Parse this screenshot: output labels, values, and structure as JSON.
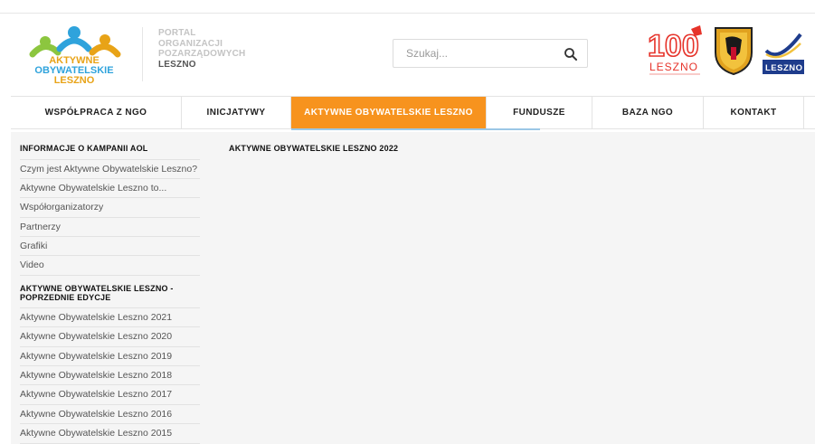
{
  "header": {
    "logo": {
      "line1": "AKTYWNE",
      "line2": "OBYWATELSKIE",
      "line3": "LESZNO"
    },
    "portal": {
      "line1": "PORTAL",
      "line2": "ORGANIZACJI",
      "line3": "POZARZĄDOWYCH",
      "line4": "LESZNO"
    },
    "search": {
      "placeholder": "Szukaj..."
    },
    "partner_logos": {
      "logo100_text": "LESZNO",
      "leszno3_text": "LESZNO"
    }
  },
  "nav": {
    "items": [
      {
        "label": "WSPÓŁPRACA Z NGO"
      },
      {
        "label": "INICJATYWY"
      },
      {
        "label": "AKTYWNE OBYWATELSKIE LESZNO"
      },
      {
        "label": "FUNDUSZE"
      },
      {
        "label": "BAZA NGO"
      },
      {
        "label": "KONTAKT"
      }
    ]
  },
  "sidebar": {
    "section1": {
      "title": "INFORMACJE O KAMPANII AOL",
      "items": [
        "Czym jest Aktywne Obywatelskie Leszno?",
        "Aktywne Obywatelskie Leszno to...",
        "Współorganizatorzy",
        "Partnerzy",
        "Grafiki",
        "Video"
      ]
    },
    "section2": {
      "title_line1": "AKTYWNE OBYWATELSKIE LESZNO -",
      "title_line2": "POPRZEDNIE EDYCJE",
      "items": [
        "Aktywne Obywatelskie Leszno 2021",
        "Aktywne Obywatelskie Leszno 2020",
        "Aktywne Obywatelskie Leszno 2019",
        "Aktywne Obywatelskie Leszno 2018",
        "Aktywne Obywatelskie Leszno 2017",
        "Aktywne Obywatelskie Leszno 2016",
        "Aktywne Obywatelskie Leszno 2015"
      ]
    }
  },
  "main": {
    "title": "AKTYWNE OBYWATELSKIE LESZNO 2022"
  },
  "colors": {
    "accent": "#f7931e",
    "logo_blue": "#2fa3dc",
    "logo_yellow": "#e8a317",
    "logo_green": "#8cc63f"
  }
}
